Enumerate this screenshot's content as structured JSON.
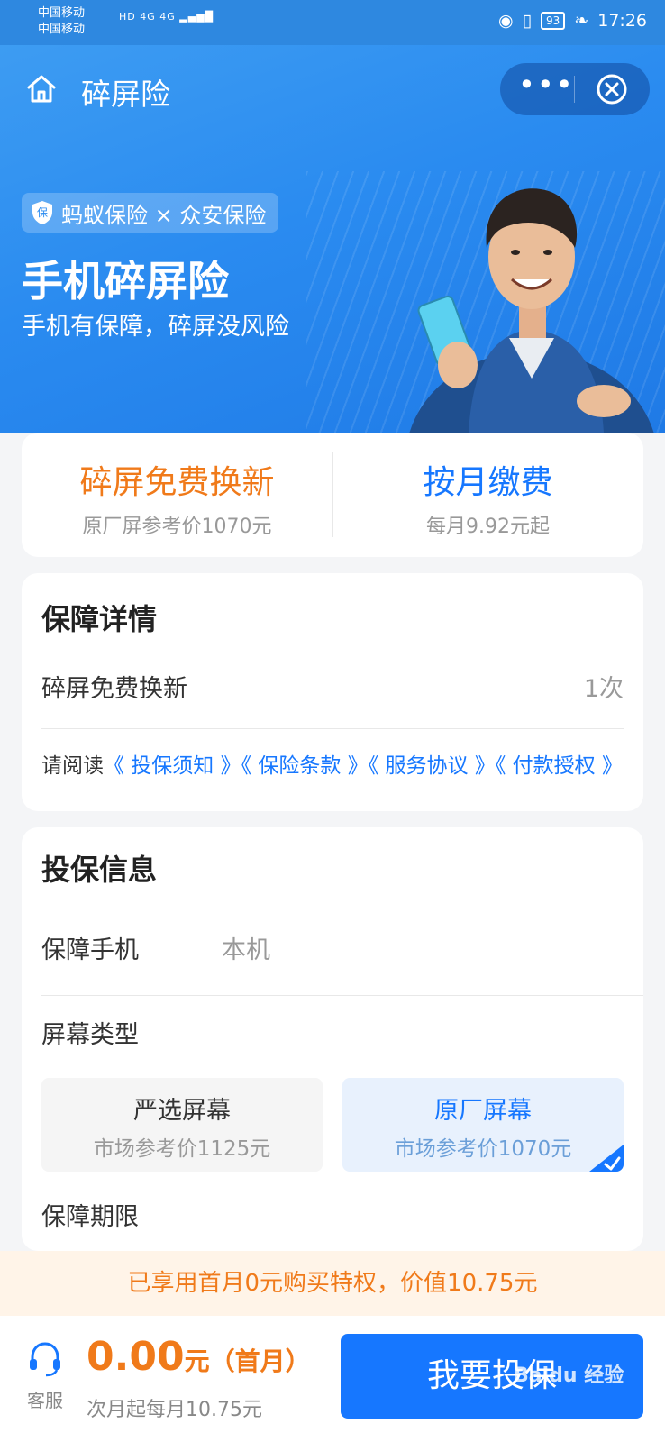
{
  "status_bar": {
    "carrier_1": "中国移动",
    "carrier_2": "中国移动",
    "hd": "HD",
    "signal": "4G 4G",
    "battery": "93",
    "time": "17:26"
  },
  "nav": {
    "title": "碎屏险",
    "more_label": "•••"
  },
  "hero": {
    "brand": "蚂蚁保险 × 众安保险",
    "shield_char": "保",
    "title": "手机碎屏险",
    "subtitle": "手机有保障，碎屏没风险"
  },
  "highlights": [
    {
      "title": "碎屏免费换新",
      "subtitle": "原厂屏参考价1070元",
      "color": "#f07a1a"
    },
    {
      "title": "按月缴费",
      "subtitle": "每月9.92元起",
      "color": "#1677ff"
    }
  ],
  "details": {
    "section_title": "保障详情",
    "row_label": "碎屏免费换新",
    "row_value": "1次",
    "terms_prefix": "请阅读",
    "terms": [
      "《 投保须知 》",
      "《 保险条款 》",
      "《 服务协议 》",
      "《 付款授权 》"
    ]
  },
  "info": {
    "section_title": "投保信息",
    "phone_label": "保障手机",
    "phone_value": "本机",
    "screen_type_label": "屏幕类型",
    "options": [
      {
        "name": "严选屏幕",
        "price": "市场参考价1125元",
        "selected": false
      },
      {
        "name": "原厂屏幕",
        "price": "市场参考价1070元",
        "selected": true
      }
    ],
    "period_label": "保障期限"
  },
  "promo": {
    "text": "已享用首月0元购买特权，价值10.75元"
  },
  "bottom": {
    "service_label": "客服",
    "price": "0.00",
    "price_unit": "元（首月）",
    "next_month": "次月起每月10.75元",
    "cta": "我要投保",
    "watermark": "Baidu 经验"
  },
  "colors": {
    "accent_blue": "#1677ff",
    "accent_orange": "#f07a1a"
  }
}
